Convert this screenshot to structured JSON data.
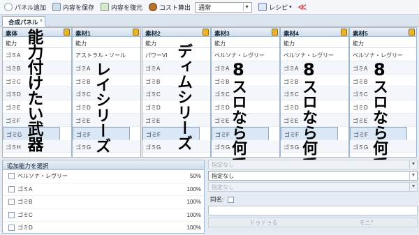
{
  "toolbar": {
    "add_panel": "パネル追加",
    "save": "内容を保存",
    "restore": "内容を復元",
    "cost": "コスト算出",
    "mode": "通常",
    "recipe": "レシピ",
    "share_icon": "share-icon"
  },
  "tab": {
    "label": "合成パネル"
  },
  "columns": [
    {
      "header": "素体",
      "sub": "能力",
      "rows": [
        "ゴミA",
        "ゴミB",
        "ゴミC",
        "ゴミD",
        "ゴミE",
        "ゴミF",
        "ゴミG",
        "ゴミH"
      ]
    },
    {
      "header": "素材1",
      "sub": "能力",
      "rows": [
        "アストラル・ソール",
        "ゴミA",
        "ゴミB",
        "ゴミC",
        "ゴミD",
        "ゴミE",
        "ゴミF",
        "ゴミG"
      ]
    },
    {
      "header": "素材2",
      "sub": "能力",
      "rows": [
        "パワーVI",
        "ゴミA",
        "ゴミB",
        "ゴミC",
        "ゴミD",
        "ゴミE",
        "ゴミF",
        "ゴミG"
      ]
    },
    {
      "header": "素材3",
      "sub": "能力",
      "rows": [
        "ペルソナ・レヴリー",
        "ゴミA",
        "ゴミB",
        "ゴミC",
        "ゴミD",
        "ゴミE",
        "ゴミF",
        "ゴミG"
      ]
    },
    {
      "header": "素材4",
      "sub": "能力",
      "rows": [
        "ペルソナ・レヴリー",
        "ゴミA",
        "ゴミB",
        "ゴミC",
        "ゴミD",
        "ゴミE",
        "ゴミF",
        "ゴミG"
      ]
    },
    {
      "header": "素材5",
      "sub": "能力",
      "rows": [
        "ペルソナ・レヴリー",
        "ゴミA",
        "ゴミB",
        "ゴミC",
        "ゴミD",
        "ゴミE",
        "ゴミF",
        "ゴミG"
      ]
    }
  ],
  "annotations": {
    "a0": "能力付けたい武器",
    "a1": "レイシリーズ",
    "a2": "ディムシリーズ",
    "a3_top": "8",
    "a3_main": "スロなら何でも",
    "a4_top": "8",
    "a4_main": "スロなら何でも",
    "a5_top": "8",
    "a5_main": "スロなら何でも"
  },
  "left_panel": {
    "title": "追加能力を選択",
    "items": [
      {
        "name": "ペルソナ・レヴリー",
        "pct": "50%"
      },
      {
        "name": "ゴミA",
        "pct": "100%"
      },
      {
        "name": "ゴミB",
        "pct": "100%"
      },
      {
        "name": "ゴミC",
        "pct": "100%"
      },
      {
        "name": "ゴミD",
        "pct": "100%"
      }
    ]
  },
  "right_panel": {
    "dd1": "指定なし",
    "dd2": "指定なし",
    "dd3": "指定なし",
    "same_name": "同名:",
    "btn1": "ドゥドゥる",
    "btn2": "モニ？"
  }
}
